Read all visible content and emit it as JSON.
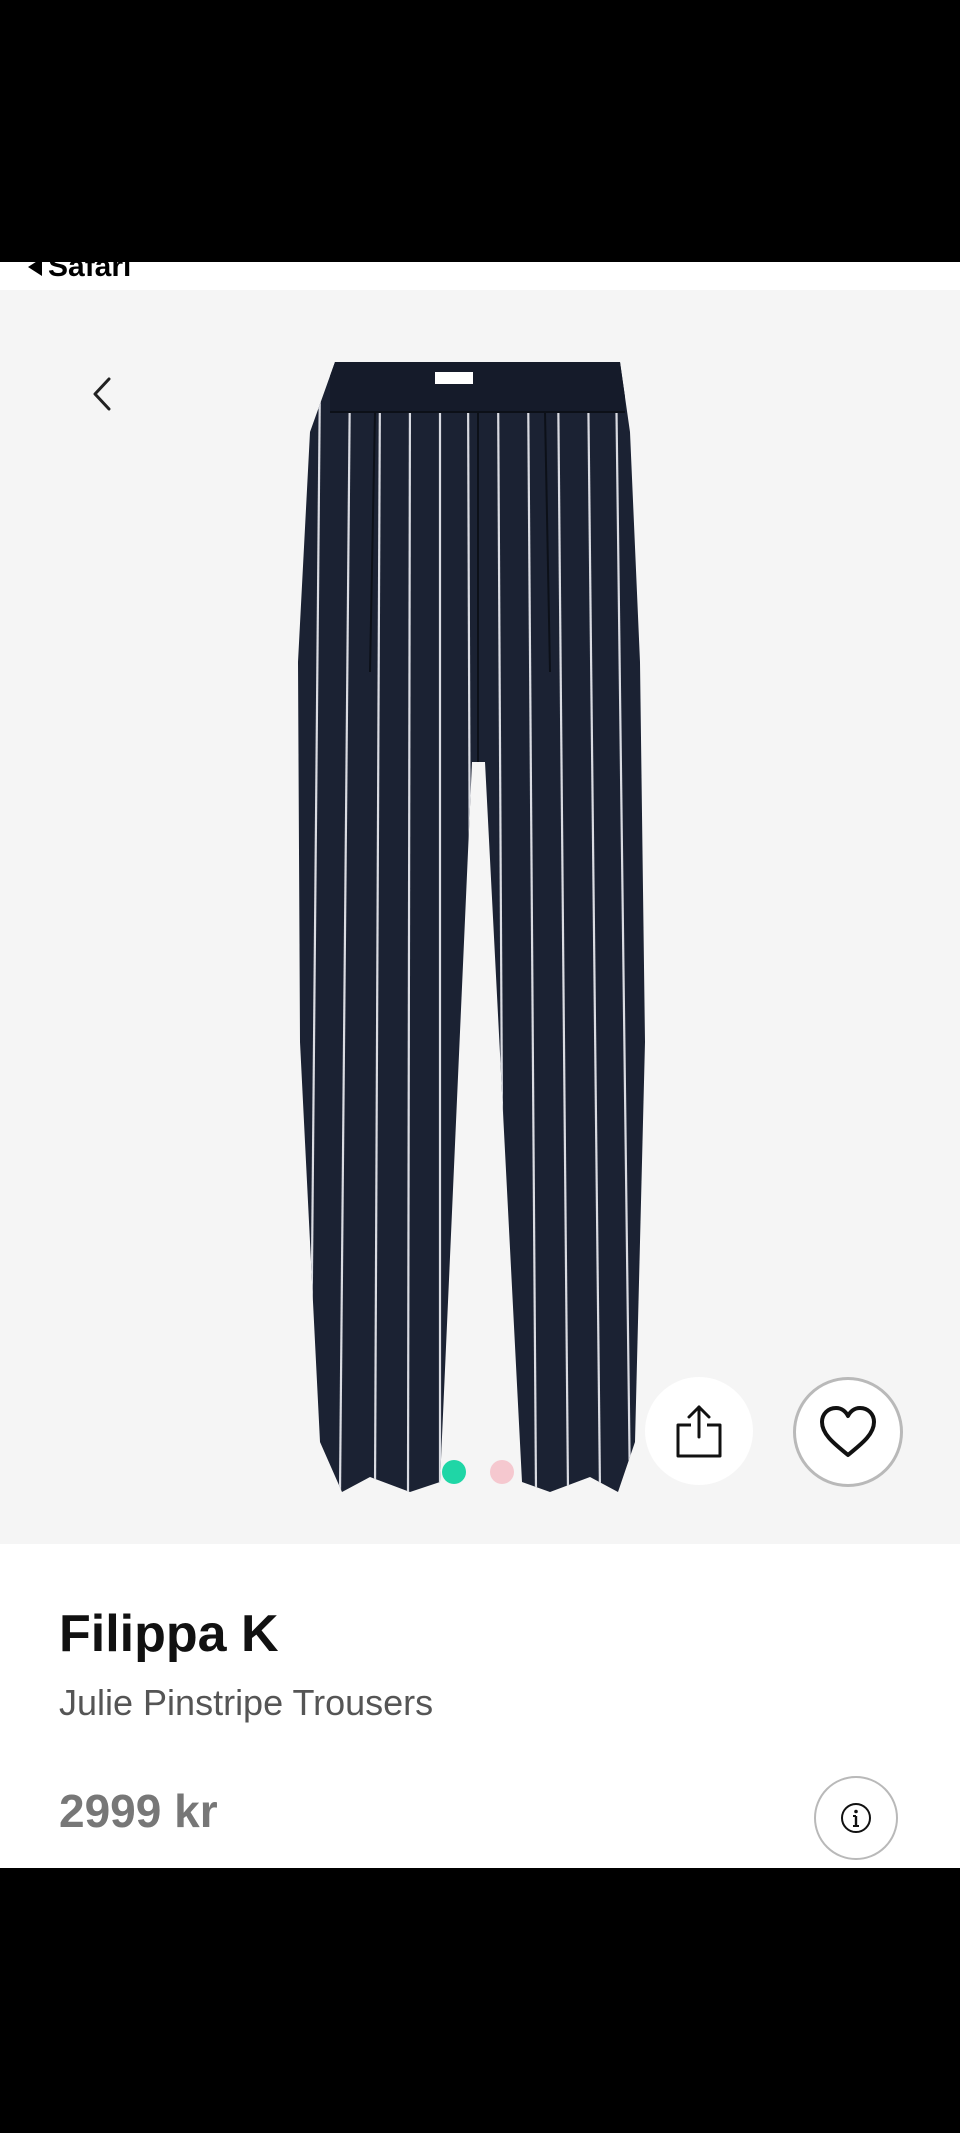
{
  "status_bar": {
    "back_label": "Safari"
  },
  "gallery": {
    "dots": [
      {
        "active": true,
        "color": "#1fd6a6"
      },
      {
        "active": false,
        "color": "#f5c8cf"
      }
    ],
    "share_icon": "share-icon",
    "favorite_icon": "heart-icon",
    "back_icon": "chevron-left-icon"
  },
  "product": {
    "brand": "Filippa K",
    "name": "Julie Pinstripe Trousers",
    "price": "2999 kr",
    "info_icon": "info-icon"
  },
  "colors": {
    "hero_background": "#f5f5f5",
    "trouser_navy": "#1b2233",
    "accent_green": "#1fd6a6"
  }
}
